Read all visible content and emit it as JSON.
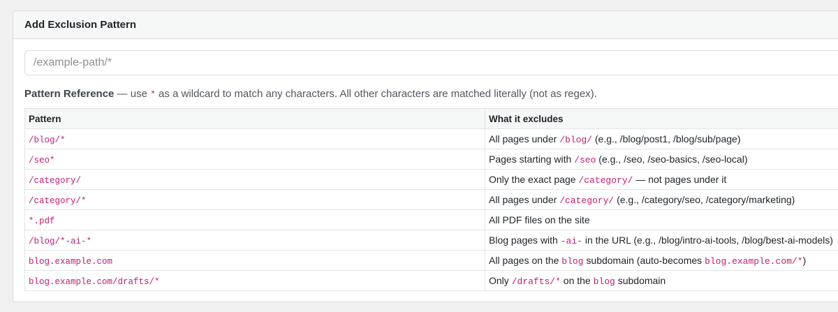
{
  "card": {
    "title": "Add Exclusion Pattern"
  },
  "input": {
    "placeholder": "/example-path/*",
    "value": ""
  },
  "reference": {
    "title": "Pattern Reference",
    "before_code": " — use ",
    "wildcard": "*",
    "after_code": " as a wildcard to match any characters. All other characters are matched literally (not as regex)."
  },
  "table": {
    "headers": [
      "Pattern",
      "What it excludes"
    ],
    "rows": [
      {
        "pattern": "/blog/*",
        "desc": [
          [
            "t",
            "All pages under "
          ],
          [
            "c",
            "/blog/"
          ],
          [
            "t",
            " (e.g., /blog/post1, /blog/sub/page)"
          ]
        ]
      },
      {
        "pattern": "/seo*",
        "desc": [
          [
            "t",
            "Pages starting with "
          ],
          [
            "c",
            "/seo"
          ],
          [
            "t",
            " (e.g., /seo, /seo-basics, /seo-local)"
          ]
        ]
      },
      {
        "pattern": "/category/",
        "desc": [
          [
            "t",
            "Only the exact page "
          ],
          [
            "c",
            "/category/"
          ],
          [
            "t",
            " — not pages under it"
          ]
        ]
      },
      {
        "pattern": "/category/*",
        "desc": [
          [
            "t",
            "All pages under "
          ],
          [
            "c",
            "/category/"
          ],
          [
            "t",
            " (e.g., /category/seo, /category/marketing)"
          ]
        ]
      },
      {
        "pattern": "*.pdf",
        "desc": [
          [
            "t",
            "All PDF files on the site"
          ]
        ]
      },
      {
        "pattern": "/blog/*-ai-*",
        "desc": [
          [
            "t",
            "Blog pages with "
          ],
          [
            "c",
            "-ai-"
          ],
          [
            "t",
            " in the URL (e.g., /blog/intro-ai-tools, /blog/best-ai-models)"
          ]
        ]
      },
      {
        "pattern": "blog.example.com",
        "desc": [
          [
            "t",
            "All pages on the "
          ],
          [
            "c",
            "blog"
          ],
          [
            "t",
            " subdomain (auto-becomes "
          ],
          [
            "c",
            "blog.example.com/*"
          ],
          [
            "t",
            ")"
          ]
        ]
      },
      {
        "pattern": "blog.example.com/drafts/*",
        "desc": [
          [
            "t",
            "Only "
          ],
          [
            "c",
            "/drafts/*"
          ],
          [
            "t",
            " on the "
          ],
          [
            "c",
            "blog"
          ],
          [
            "t",
            " subdomain"
          ]
        ]
      }
    ]
  },
  "colors": {
    "code": "#c01c75",
    "header_bg": "#f6f7f7",
    "page_bg": "#f0f0f1"
  }
}
